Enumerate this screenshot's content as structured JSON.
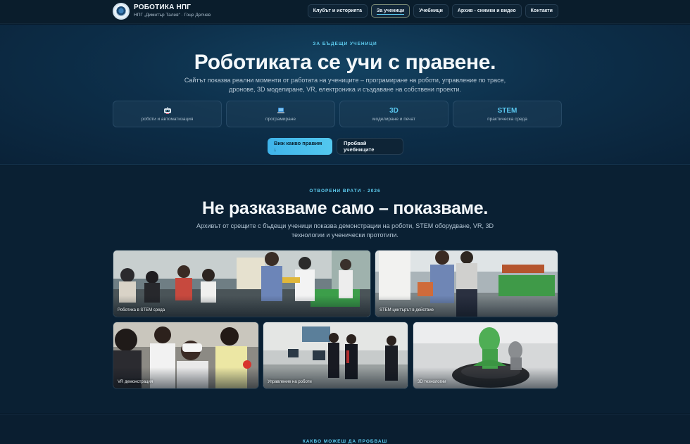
{
  "brand": {
    "title": "РОБОТИКА НПГ",
    "subtitle": "НПГ „Димитър Талев“ · Гоце Делчев"
  },
  "nav": {
    "items": [
      {
        "label": "Клубът и историята",
        "active": false
      },
      {
        "label": "За ученици",
        "active": true
      },
      {
        "label": "Учебници",
        "active": false
      },
      {
        "label": "Архив - снимки и видео",
        "active": false
      },
      {
        "label": "Контакти",
        "active": false
      }
    ]
  },
  "hero": {
    "eyebrow": "ЗА БЪДЕЩИ УЧЕНИЦИ",
    "title": "Роботиката се учи с правене.",
    "description": "Сайтът показва реални моменти от работата на учениците – програмиране на роботи, управление по трасе, дронове, 3D моделиране, VR, електроника и създаване на собствени проекти.",
    "features": [
      {
        "icon": "robot-icon",
        "badge": "",
        "label": "роботи и автоматизация"
      },
      {
        "icon": "laptop-icon",
        "badge": "",
        "label": "програмиране"
      },
      {
        "icon": "",
        "badge": "3D",
        "label": "моделиране и печат"
      },
      {
        "icon": "",
        "badge": "STEM",
        "label": "практическа среда"
      }
    ],
    "primary_button": "Виж какво правим ↓",
    "secondary_button": "Пробвай учебниците"
  },
  "open_doors": {
    "eyebrow": "ОТВОРЕНИ ВРАТИ · 2026",
    "title": "Не разказваме само – показваме.",
    "description": "Архивът от срещите с бъдещи ученици показва демонстрации на роботи, STEM оборудване, VR, 3D технологии и ученически прототипи.",
    "photos": [
      {
        "caption": "Роботика в STEM среда"
      },
      {
        "caption": "STEM центърът в действие"
      },
      {
        "caption": "VR демонстрация"
      },
      {
        "caption": "Управление на роботи"
      },
      {
        "caption": "3D технологии"
      }
    ]
  },
  "try_section": {
    "eyebrow": "КАКВО МОЖЕШ ДА ПРОБВАШ"
  },
  "colors": {
    "accent": "#59c7ef",
    "background": "#071a2b",
    "primary_button": "#4cc1ee"
  }
}
